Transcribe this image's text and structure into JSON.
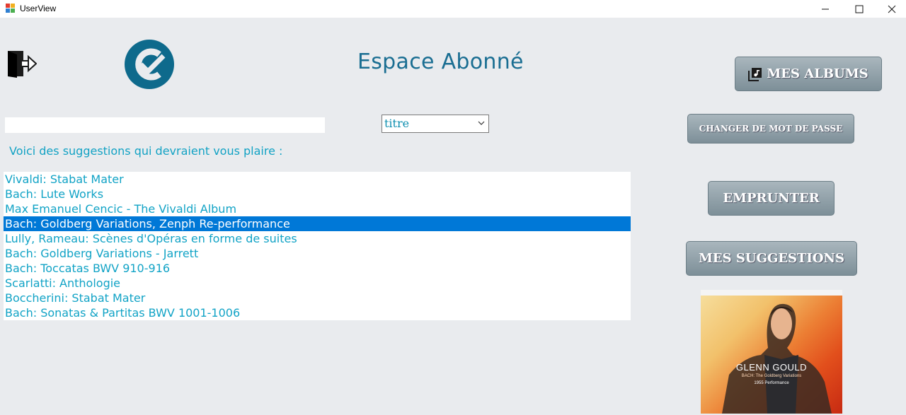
{
  "window": {
    "title": "UserView",
    "minimize": "—",
    "maximize": "☐",
    "close": "✕"
  },
  "header": {
    "title": "Espace Abonné",
    "exit_icon": "logout-door-icon",
    "logo_icon": "brand-logo"
  },
  "search": {
    "value": "",
    "placeholder": ""
  },
  "filter": {
    "selected": "titre"
  },
  "suggestions": {
    "label": "Voici des suggestions qui devraient vous plaire :",
    "items": [
      "Vivaldi: Stabat Mater",
      "Bach: Lute Works",
      "Max Emanuel Cencic - The Vivaldi Album",
      "Bach: Goldberg Variations, Zenph Re-performance",
      "Lully, Rameau: Scènes d'Opéras en forme de suites",
      "Bach: Goldberg Variations - Jarrett",
      "Bach: Toccatas BWV 910-916",
      "Scarlatti: Anthologie",
      "Boccherini: Stabat Mater",
      "Bach: Sonatas & Partitas BWV 1001-1006"
    ],
    "selected_index": 3
  },
  "buttons": {
    "albums": "MES ALBUMS",
    "password": "CHANGER DE MOT DE PASSE",
    "borrow": "EMPRUNTER",
    "suggestions": "MES SUGGESTIONS"
  },
  "cover": {
    "artist": "GLENN GOULD",
    "subtitle": "BACH: The Goldberg Variations",
    "subtitle2": "1955 Performance"
  },
  "colors": {
    "title": "#1a6e92",
    "text": "#11a3c6",
    "selection": "#0078d7",
    "button": "#8c9ca4"
  }
}
